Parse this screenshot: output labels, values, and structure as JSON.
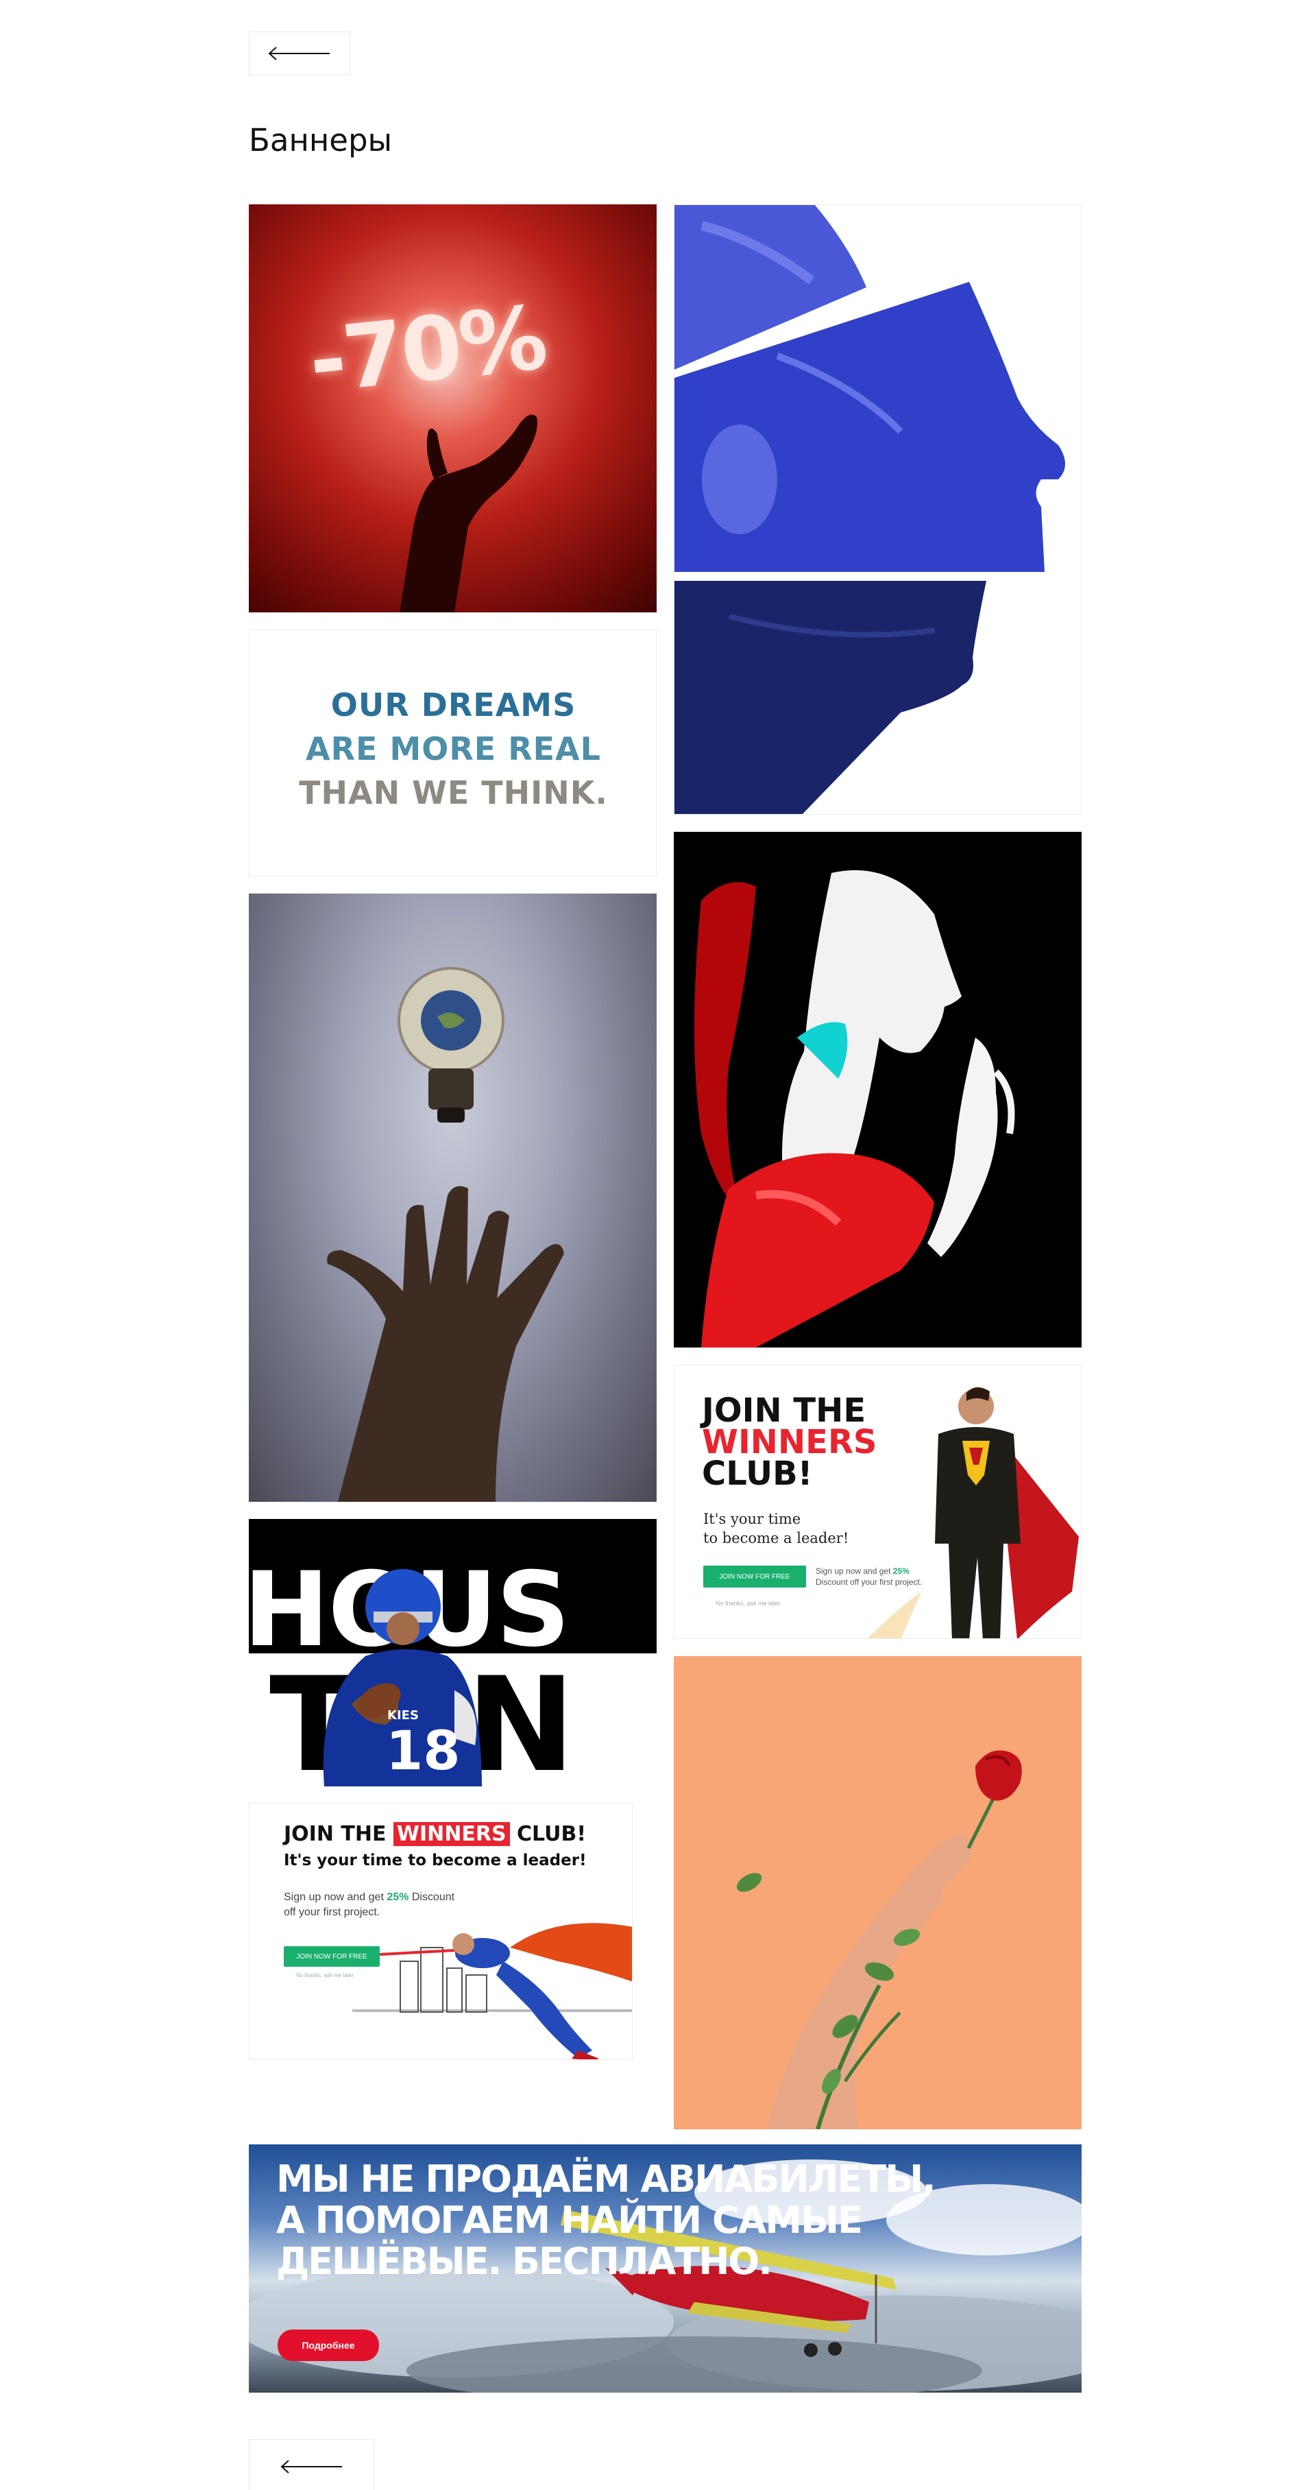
{
  "page": {
    "title": "Баннеры",
    "back_label": "back-arrow-icon"
  },
  "banners": {
    "sale": {
      "text": "-70%"
    },
    "dreams": {
      "line1": "OUR DREAMS",
      "line2": "ARE MORE REAL",
      "line3": "THAN WE THINK."
    },
    "houston": {
      "line1": "HOUS",
      "line2": "TON",
      "jersey_number": "18",
      "jersey_text": "KIES"
    },
    "winners_vertical": {
      "line1": "JOIN THE",
      "line2": "WINNERS",
      "line3": "CLUB!",
      "sub1": "It's your time",
      "sub2": "to become a leader!",
      "button": "JOIN NOW FOR FREE",
      "note1": "Sign up now and get",
      "note_pct": "25%",
      "note2": "Discount off your first project.",
      "fine": "No thanks, ask me later"
    },
    "winners_horizontal": {
      "title_a": "JOIN THE",
      "title_b": "WINNERS",
      "title_c": "CLUB!",
      "subtitle": "It's your time to become a leader!",
      "text1": "Sign up now and get",
      "pct": "25%",
      "text2": "Discount",
      "text3": "off your first project.",
      "button": "JOIN NOW FOR FREE",
      "fine": "No thanks, ask me later"
    },
    "flights": {
      "line1": "МЫ НЕ ПРОДАЁМ АВИАБИЛЕТЫ,",
      "line2": "А ПОМОГАЕМ НАЙТИ САМЫЕ",
      "line3": "ДЕШЁВЫЕ. БЕСПЛАТНО.",
      "button": "Подробнее"
    }
  },
  "colors": {
    "accent_red": "#e8242f",
    "accent_green": "#19b06e",
    "peach": "#f9a677",
    "cobalt": "#3040c8"
  }
}
